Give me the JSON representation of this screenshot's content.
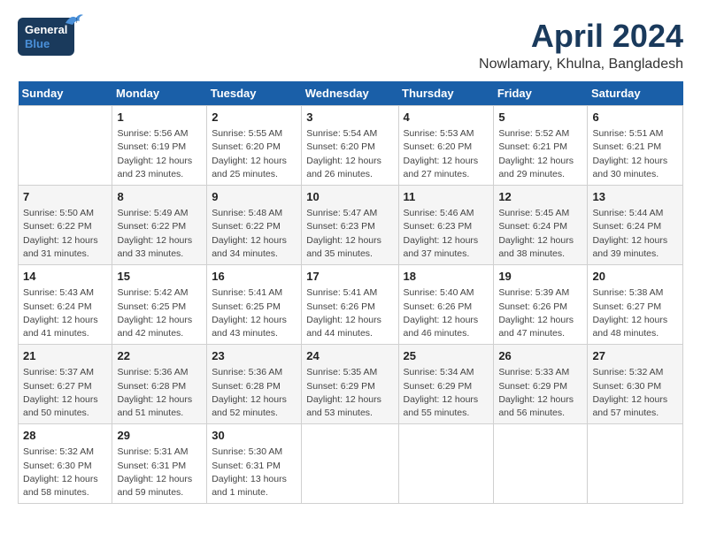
{
  "logo": {
    "line1": "General",
    "line2": "Blue"
  },
  "title": "April 2024",
  "location": "Nowlamary, Khulna, Bangladesh",
  "days_of_week": [
    "Sunday",
    "Monday",
    "Tuesday",
    "Wednesday",
    "Thursday",
    "Friday",
    "Saturday"
  ],
  "weeks": [
    [
      {
        "day": "",
        "info": ""
      },
      {
        "day": "1",
        "info": "Sunrise: 5:56 AM\nSunset: 6:19 PM\nDaylight: 12 hours\nand 23 minutes."
      },
      {
        "day": "2",
        "info": "Sunrise: 5:55 AM\nSunset: 6:20 PM\nDaylight: 12 hours\nand 25 minutes."
      },
      {
        "day": "3",
        "info": "Sunrise: 5:54 AM\nSunset: 6:20 PM\nDaylight: 12 hours\nand 26 minutes."
      },
      {
        "day": "4",
        "info": "Sunrise: 5:53 AM\nSunset: 6:20 PM\nDaylight: 12 hours\nand 27 minutes."
      },
      {
        "day": "5",
        "info": "Sunrise: 5:52 AM\nSunset: 6:21 PM\nDaylight: 12 hours\nand 29 minutes."
      },
      {
        "day": "6",
        "info": "Sunrise: 5:51 AM\nSunset: 6:21 PM\nDaylight: 12 hours\nand 30 minutes."
      }
    ],
    [
      {
        "day": "7",
        "info": "Sunrise: 5:50 AM\nSunset: 6:22 PM\nDaylight: 12 hours\nand 31 minutes."
      },
      {
        "day": "8",
        "info": "Sunrise: 5:49 AM\nSunset: 6:22 PM\nDaylight: 12 hours\nand 33 minutes."
      },
      {
        "day": "9",
        "info": "Sunrise: 5:48 AM\nSunset: 6:22 PM\nDaylight: 12 hours\nand 34 minutes."
      },
      {
        "day": "10",
        "info": "Sunrise: 5:47 AM\nSunset: 6:23 PM\nDaylight: 12 hours\nand 35 minutes."
      },
      {
        "day": "11",
        "info": "Sunrise: 5:46 AM\nSunset: 6:23 PM\nDaylight: 12 hours\nand 37 minutes."
      },
      {
        "day": "12",
        "info": "Sunrise: 5:45 AM\nSunset: 6:24 PM\nDaylight: 12 hours\nand 38 minutes."
      },
      {
        "day": "13",
        "info": "Sunrise: 5:44 AM\nSunset: 6:24 PM\nDaylight: 12 hours\nand 39 minutes."
      }
    ],
    [
      {
        "day": "14",
        "info": "Sunrise: 5:43 AM\nSunset: 6:24 PM\nDaylight: 12 hours\nand 41 minutes."
      },
      {
        "day": "15",
        "info": "Sunrise: 5:42 AM\nSunset: 6:25 PM\nDaylight: 12 hours\nand 42 minutes."
      },
      {
        "day": "16",
        "info": "Sunrise: 5:41 AM\nSunset: 6:25 PM\nDaylight: 12 hours\nand 43 minutes."
      },
      {
        "day": "17",
        "info": "Sunrise: 5:41 AM\nSunset: 6:26 PM\nDaylight: 12 hours\nand 44 minutes."
      },
      {
        "day": "18",
        "info": "Sunrise: 5:40 AM\nSunset: 6:26 PM\nDaylight: 12 hours\nand 46 minutes."
      },
      {
        "day": "19",
        "info": "Sunrise: 5:39 AM\nSunset: 6:26 PM\nDaylight: 12 hours\nand 47 minutes."
      },
      {
        "day": "20",
        "info": "Sunrise: 5:38 AM\nSunset: 6:27 PM\nDaylight: 12 hours\nand 48 minutes."
      }
    ],
    [
      {
        "day": "21",
        "info": "Sunrise: 5:37 AM\nSunset: 6:27 PM\nDaylight: 12 hours\nand 50 minutes."
      },
      {
        "day": "22",
        "info": "Sunrise: 5:36 AM\nSunset: 6:28 PM\nDaylight: 12 hours\nand 51 minutes."
      },
      {
        "day": "23",
        "info": "Sunrise: 5:36 AM\nSunset: 6:28 PM\nDaylight: 12 hours\nand 52 minutes."
      },
      {
        "day": "24",
        "info": "Sunrise: 5:35 AM\nSunset: 6:29 PM\nDaylight: 12 hours\nand 53 minutes."
      },
      {
        "day": "25",
        "info": "Sunrise: 5:34 AM\nSunset: 6:29 PM\nDaylight: 12 hours\nand 55 minutes."
      },
      {
        "day": "26",
        "info": "Sunrise: 5:33 AM\nSunset: 6:29 PM\nDaylight: 12 hours\nand 56 minutes."
      },
      {
        "day": "27",
        "info": "Sunrise: 5:32 AM\nSunset: 6:30 PM\nDaylight: 12 hours\nand 57 minutes."
      }
    ],
    [
      {
        "day": "28",
        "info": "Sunrise: 5:32 AM\nSunset: 6:30 PM\nDaylight: 12 hours\nand 58 minutes."
      },
      {
        "day": "29",
        "info": "Sunrise: 5:31 AM\nSunset: 6:31 PM\nDaylight: 12 hours\nand 59 minutes."
      },
      {
        "day": "30",
        "info": "Sunrise: 5:30 AM\nSunset: 6:31 PM\nDaylight: 13 hours\nand 1 minute."
      },
      {
        "day": "",
        "info": ""
      },
      {
        "day": "",
        "info": ""
      },
      {
        "day": "",
        "info": ""
      },
      {
        "day": "",
        "info": ""
      }
    ]
  ]
}
